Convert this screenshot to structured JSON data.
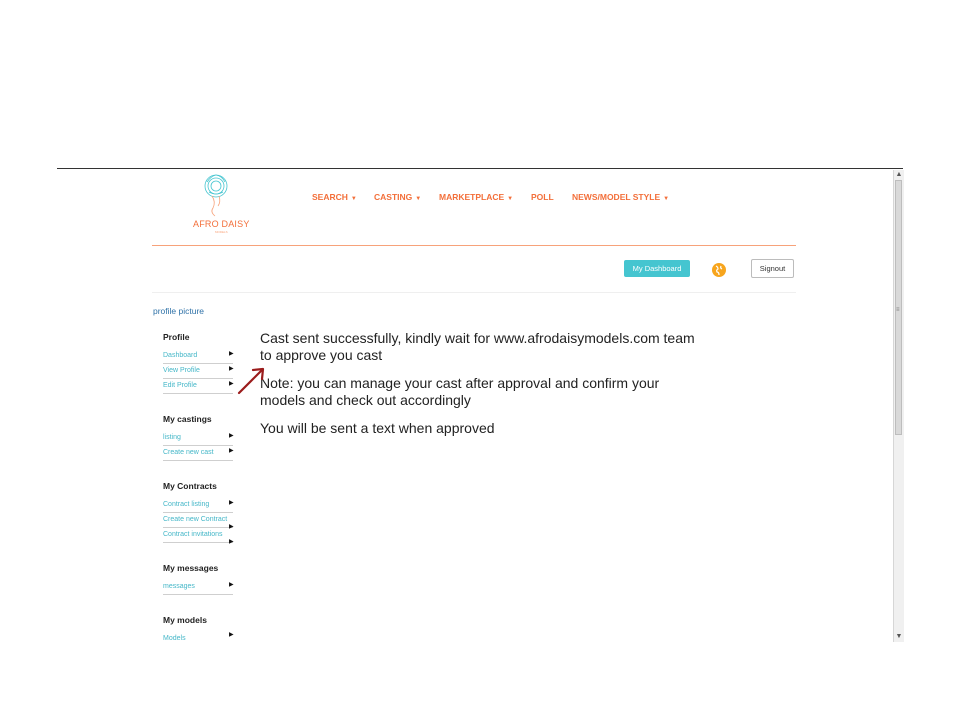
{
  "logo": {
    "word_part1": "AFR",
    "word_mark": "O",
    "word_part2": " DAISY",
    "tagline": "MODELS"
  },
  "nav": {
    "items": [
      {
        "label": "SEARCH",
        "caret": "▼"
      },
      {
        "label": "CASTING",
        "caret": "▼"
      },
      {
        "label": "MARKETPLACE",
        "caret": "▼"
      },
      {
        "label": "POLL",
        "caret": ""
      },
      {
        "label": "NEWS/MODEL STYLE",
        "caret": "▼"
      }
    ]
  },
  "header": {
    "dashboard_label": "My Dashboard",
    "signout_label": "Signout",
    "globe_icon": "globe-icon"
  },
  "sidebar": {
    "profile_picture": "profile picture",
    "sections": [
      {
        "heading": "Profile",
        "links": [
          "Dashboard",
          "View Profile",
          "Edit Profile"
        ]
      },
      {
        "heading": "My castings",
        "links": [
          "listing",
          "Create new cast"
        ]
      },
      {
        "heading": "My Contracts",
        "links": [
          "Contract listing",
          "Create new Contract",
          "Contract invitations"
        ]
      },
      {
        "heading": "My messages",
        "links": [
          "messages"
        ]
      },
      {
        "heading": "My models",
        "links": [
          "Models"
        ]
      }
    ]
  },
  "main": {
    "success_line1": "Cast sent successfully, kindly wait for www.afrodaisymodels.com team",
    "success_line2": "to approve you cast",
    "note_line1": "Note: you can manage your cast after approval and confirm your",
    "note_line2": "models and check out accordingly",
    "text_line": "You will be sent a text when approved"
  },
  "colors": {
    "brand_orange": "#f36f3a",
    "accent_teal": "#45c5d0",
    "link_blue": "#45b7c8",
    "annotation_red": "#9b1c1c"
  }
}
